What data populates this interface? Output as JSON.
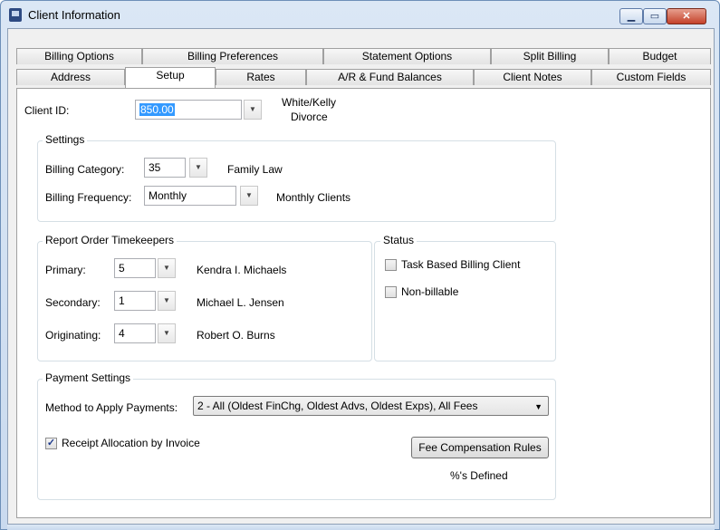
{
  "window": {
    "title": "Client Information",
    "min_glyph": "▁",
    "max_glyph": "▭",
    "close_glyph": "✕"
  },
  "tabs_row1": [
    "Billing Options",
    "Billing Preferences",
    "Statement Options",
    "Split Billing",
    "Budget"
  ],
  "tabs_row2": [
    "Address",
    "Setup",
    "Rates",
    "A/R & Fund Balances",
    "Client Notes",
    "Custom Fields"
  ],
  "active_tab": "Setup",
  "client": {
    "label": "Client ID:",
    "id_value": "850.00",
    "name_line1": "White/Kelly",
    "name_line2": "Divorce"
  },
  "settings": {
    "group_label": "Settings",
    "billing_category_label": "Billing Category:",
    "billing_category_value": "35",
    "billing_category_desc": "Family Law",
    "billing_frequency_label": "Billing Frequency:",
    "billing_frequency_value": "Monthly",
    "billing_frequency_desc": "Monthly Clients"
  },
  "timekeepers": {
    "group_label": "Report Order Timekeepers",
    "primary_label": "Primary:",
    "primary_value": "5",
    "primary_name": "Kendra I. Michaels",
    "secondary_label": "Secondary:",
    "secondary_value": "1",
    "secondary_name": "Michael L. Jensen",
    "originating_label": "Originating:",
    "originating_value": "4",
    "originating_name": "Robert O. Burns"
  },
  "status": {
    "group_label": "Status",
    "task_based_label": "Task Based Billing Client",
    "task_based_checked": false,
    "non_billable_label": "Non-billable",
    "non_billable_checked": false
  },
  "payment": {
    "group_label": "Payment Settings",
    "method_label": "Method to Apply Payments:",
    "method_value": "2 - All (Oldest FinChg, Oldest Advs, Oldest Exps), All Fees",
    "receipt_label": "Receipt Allocation by Invoice",
    "receipt_checked": true,
    "check_glyph": "✓",
    "fee_button": "Fee Compensation Rules",
    "defined_text": "%'s Defined"
  },
  "dropdown_glyph": "▼"
}
